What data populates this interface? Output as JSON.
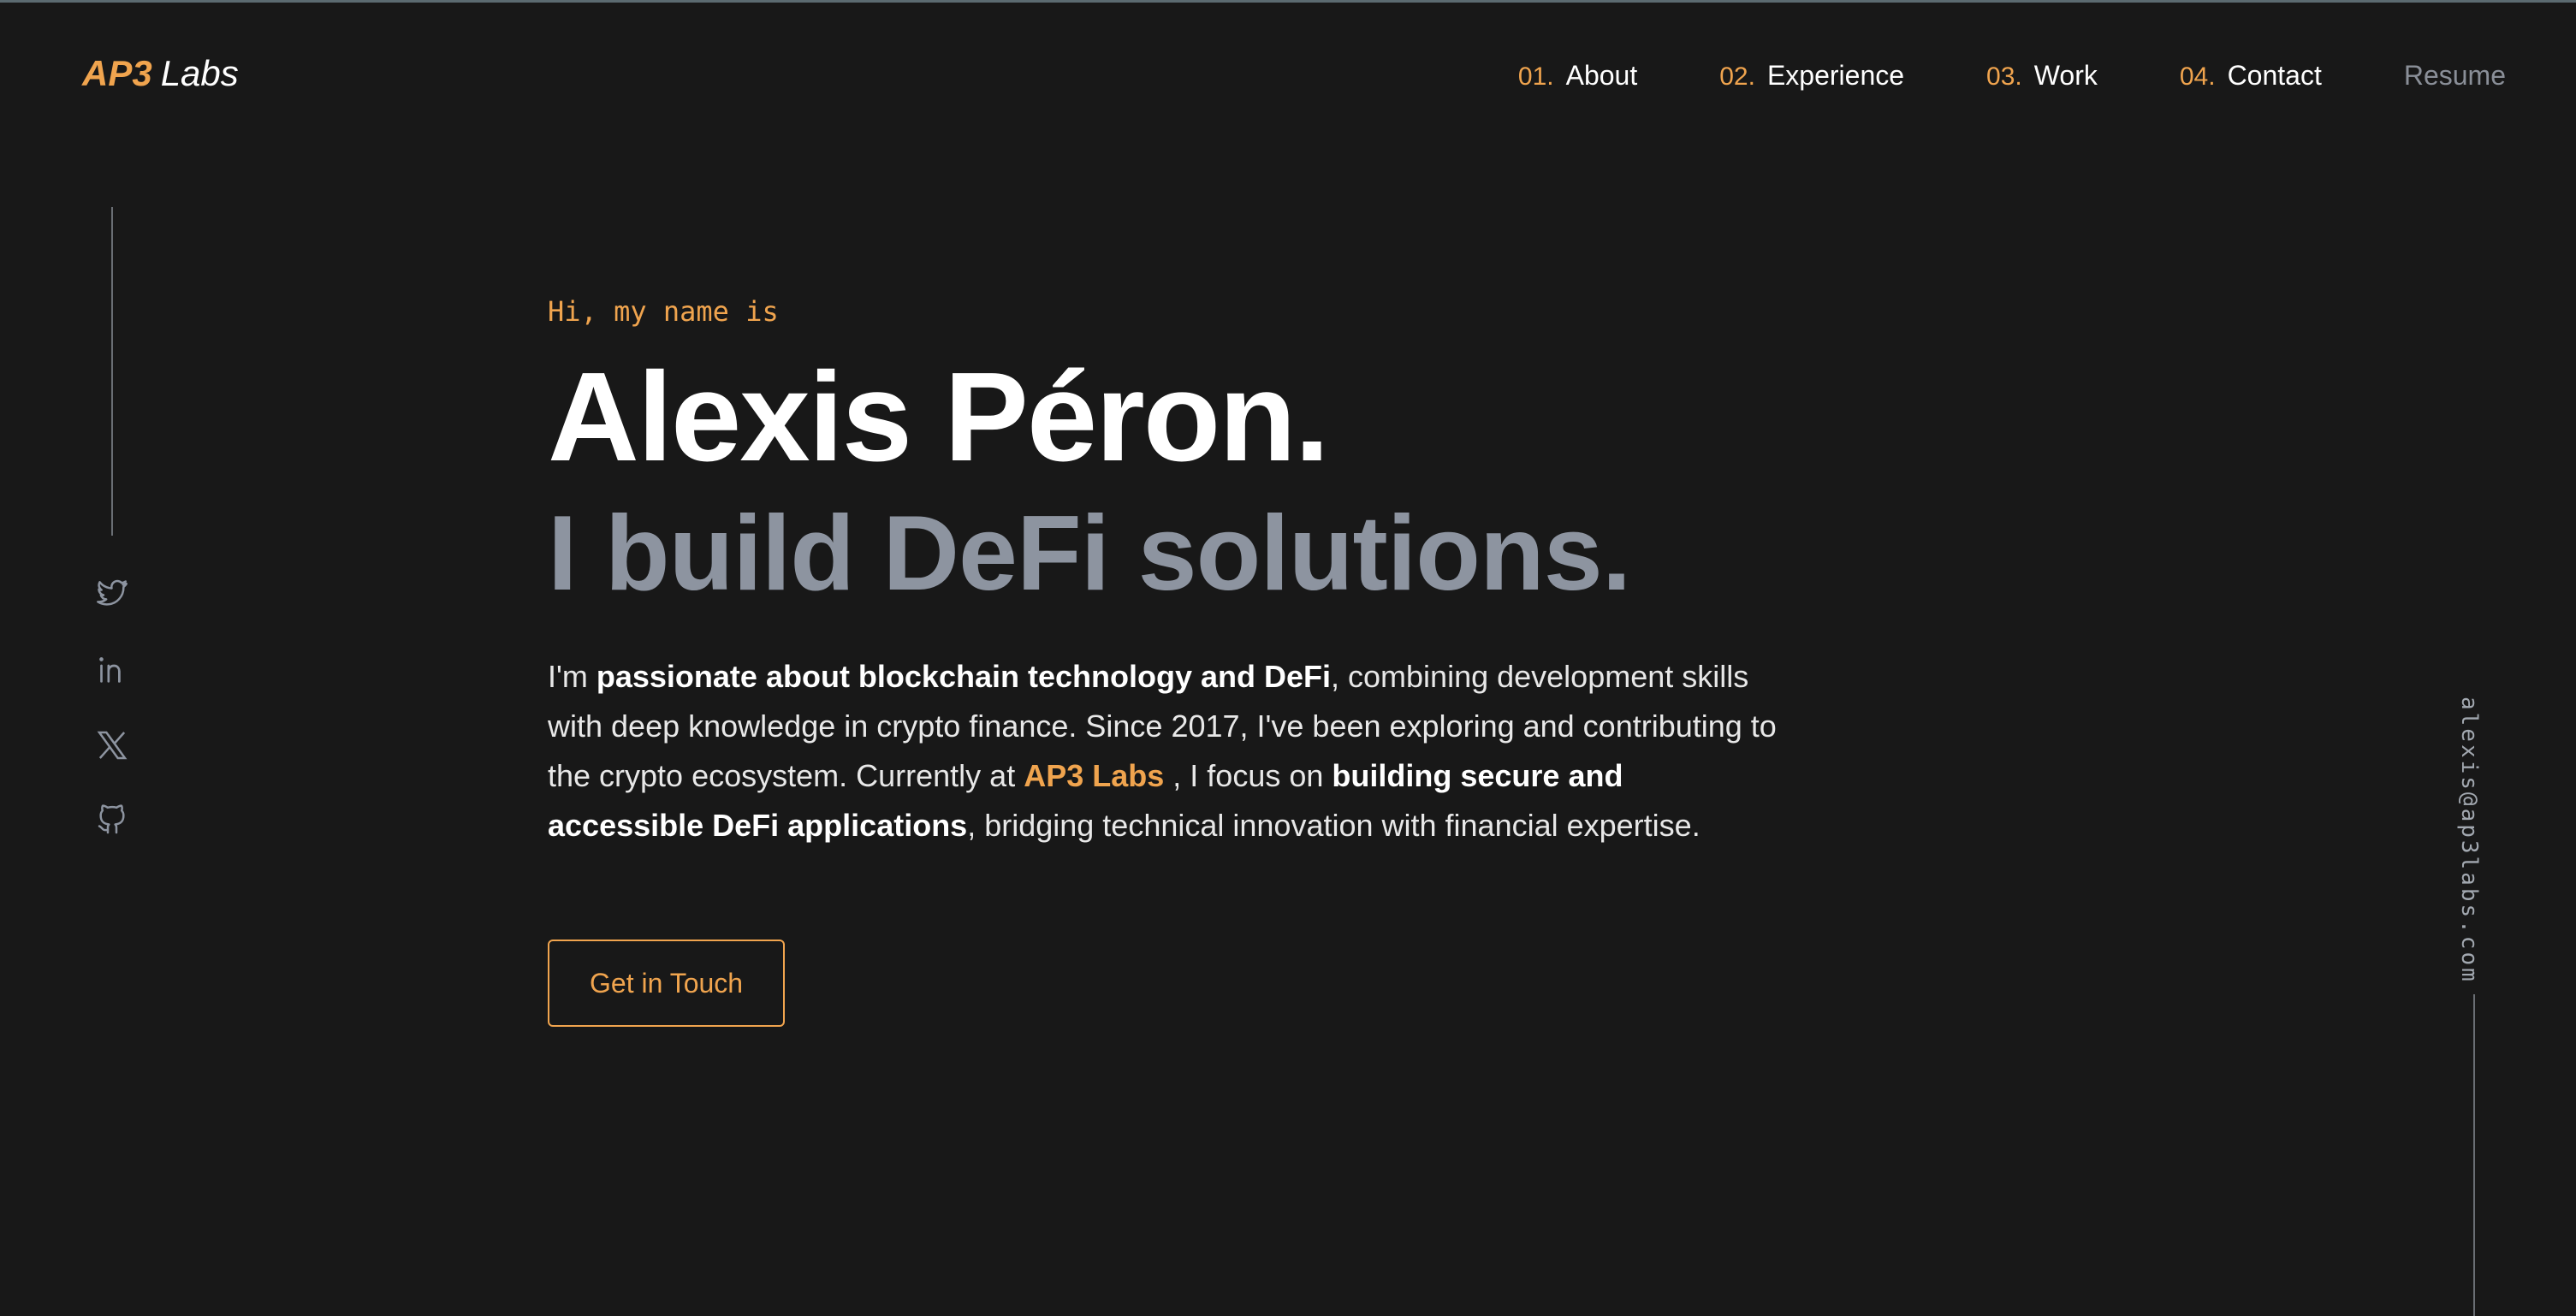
{
  "header": {
    "logo_primary": "AP3",
    "logo_secondary": "Labs",
    "nav": [
      {
        "number": "01.",
        "label": "About"
      },
      {
        "number": "02.",
        "label": "Experience"
      },
      {
        "number": "03.",
        "label": "Work"
      },
      {
        "number": "04.",
        "label": "Contact"
      }
    ],
    "resume_label": "Resume"
  },
  "social": {
    "icons": [
      "twitter-icon",
      "linkedin-icon",
      "x-icon",
      "github-icon"
    ]
  },
  "email": "alexis@ap3labs.com",
  "hero": {
    "greeting": "Hi, my name is",
    "name": "Alexis Péron.",
    "tagline": "I build DeFi solutions.",
    "bio": {
      "part1": "I'm ",
      "bold1": "passionate about blockchain technology and DeFi",
      "part2": ", combining development skills with deep knowledge in crypto finance. Since 2017, I've been exploring and contributing to the crypto ecosystem. Currently at ",
      "company": "AP3 Labs",
      "part3": " , I focus on ",
      "bold2": "building secure and accessible DeFi applications",
      "part4": ", bridging technical innovation with financial expertise."
    },
    "cta_label": "Get in Touch"
  },
  "colors": {
    "background": "#181818",
    "accent": "#f0a44e",
    "muted": "#8d94a0"
  }
}
